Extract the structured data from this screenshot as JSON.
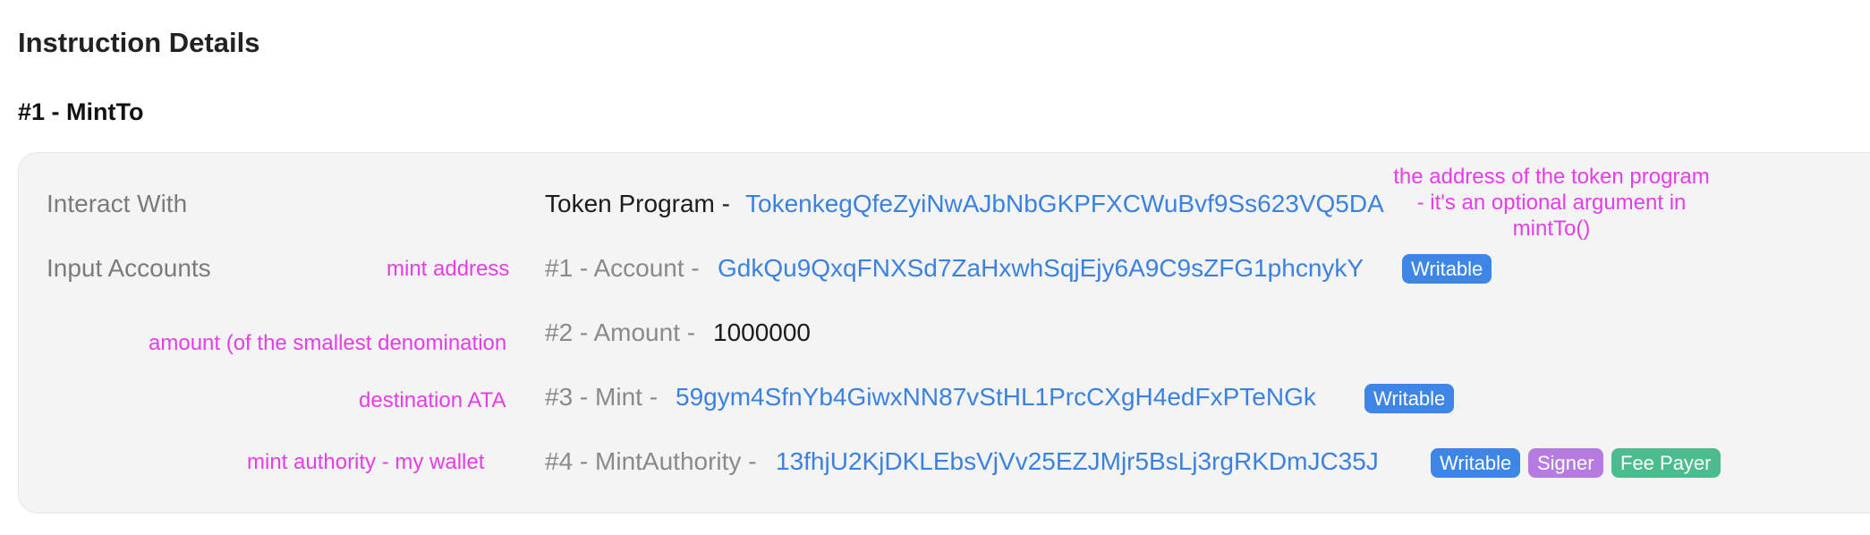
{
  "page": {
    "title": "Instruction Details"
  },
  "instruction": {
    "heading": "#1 - MintTo"
  },
  "interact": {
    "label": "Interact With",
    "prefix": "Token Program -",
    "address": "TokenkegQfeZyiNwAJbNbGKPFXCWuBvf9Ss623VQ5DA",
    "note": "the address of the token program - it's an optional argument in mintTo()"
  },
  "accounts": {
    "label": "Input Accounts",
    "rows": [
      {
        "prefix": "#1 - Account -",
        "value": "GdkQu9QxqFNXSd7ZaHxwhSqjEjy6A9C9sZFG1phcnykY",
        "badges": [
          "Writable"
        ],
        "note": "mint address"
      },
      {
        "prefix": "#2 - Amount -",
        "value": "1000000",
        "badges": [],
        "note": "amount (of the smallest denomination"
      },
      {
        "prefix": "#3 - Mint -",
        "value": "59gym4SfnYb4GiwxNN87vStHL1PrcCXgH4edFxPTeNGk",
        "badges": [
          "Writable"
        ],
        "note": "destination ATA"
      },
      {
        "prefix": "#4 - MintAuthority -",
        "value": "13fhjU2KjDKLEbsVjVv25EZJMjr5BsLj3rgRKDmJC35J",
        "badges": [
          "Writable",
          "Signer",
          "Fee Payer"
        ],
        "note": "mint authority - my wallet"
      }
    ]
  },
  "colors": {
    "link": "#3b82e0",
    "annotation": "#e53de8",
    "writable": "#3d86e6",
    "signer": "#b57be0",
    "fee_payer": "#4cbc8e"
  }
}
